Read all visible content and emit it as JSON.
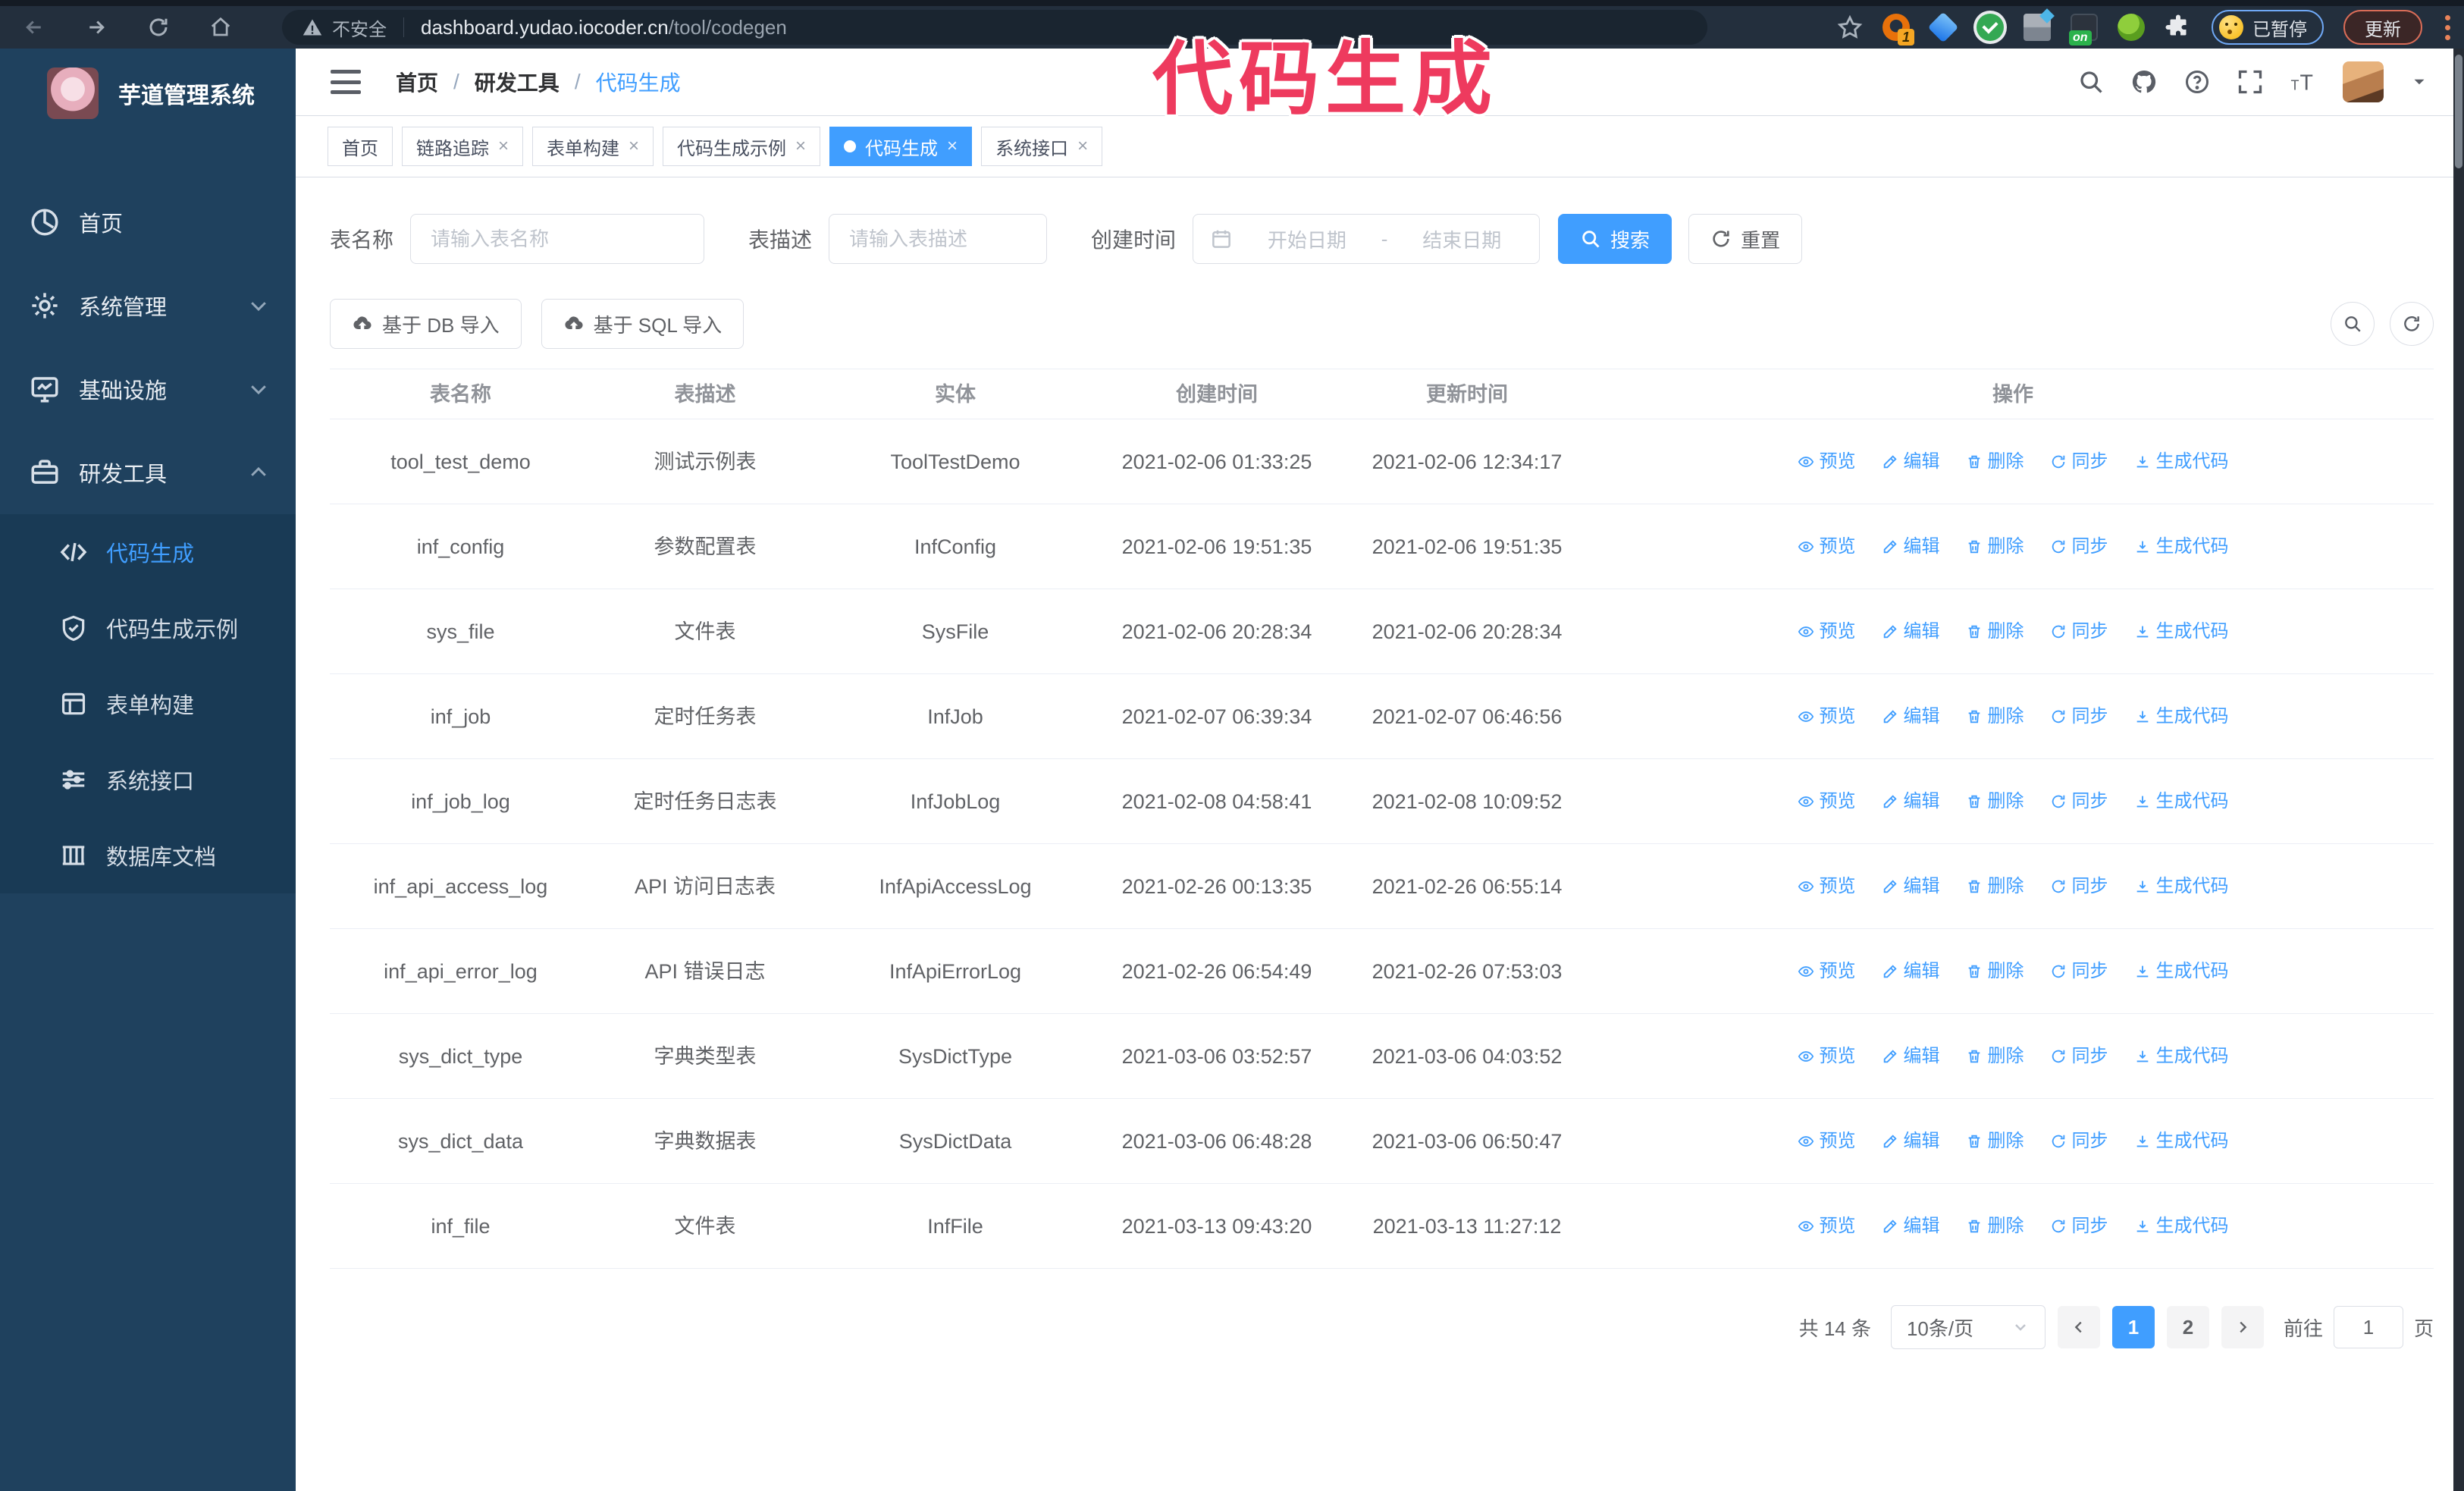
{
  "colors": {
    "primary": "#409eff",
    "sidebar_bg": "#1f415e",
    "submenu_bg": "#193a55",
    "watermark": "#ee3a5e"
  },
  "browser": {
    "security_label": "不安全",
    "url_host": "dashboard.yudao.iocoder.cn",
    "url_path": "/tool/codegen",
    "extension_badge": "1",
    "extension_on_badge": "on",
    "paused_chip": "已暂停",
    "update_button": "更新"
  },
  "overlay": {
    "watermark": "代码生成"
  },
  "sidebar": {
    "title": "芋道管理系统",
    "items": [
      {
        "label": "首页"
      },
      {
        "label": "系统管理"
      },
      {
        "label": "基础设施"
      },
      {
        "label": "研发工具"
      }
    ],
    "subitems": [
      {
        "label": "代码生成"
      },
      {
        "label": "代码生成示例"
      },
      {
        "label": "表单构建"
      },
      {
        "label": "系统接口"
      },
      {
        "label": "数据库文档"
      }
    ]
  },
  "header": {
    "breadcrumb": [
      "首页",
      "研发工具",
      "代码生成"
    ],
    "separator": "/"
  },
  "tabs": [
    {
      "label": "首页"
    },
    {
      "label": "链路追踪"
    },
    {
      "label": "表单构建"
    },
    {
      "label": "代码生成示例"
    },
    {
      "label": "代码生成"
    },
    {
      "label": "系统接口"
    }
  ],
  "filters": {
    "name_label": "表名称",
    "name_placeholder": "请输入表名称",
    "desc_label": "表描述",
    "desc_placeholder": "请输入表描述",
    "time_label": "创建时间",
    "start_placeholder": "开始日期",
    "range_separator": "-",
    "end_placeholder": "结束日期",
    "search_label": "搜索",
    "reset_label": "重置"
  },
  "toolbar": {
    "import_db": "基于 DB 导入",
    "import_sql": "基于 SQL 导入"
  },
  "table": {
    "columns": [
      "表名称",
      "表描述",
      "实体",
      "创建时间",
      "更新时间",
      "操作"
    ],
    "actions": [
      "预览",
      "编辑",
      "删除",
      "同步",
      "生成代码"
    ],
    "rows": [
      {
        "name": "tool_test_demo",
        "desc": "测试示例表",
        "entity": "ToolTestDemo",
        "created": "2021-02-06 01:33:25",
        "updated": "2021-02-06 12:34:17"
      },
      {
        "name": "inf_config",
        "desc": "参数配置表",
        "entity": "InfConfig",
        "created": "2021-02-06 19:51:35",
        "updated": "2021-02-06 19:51:35"
      },
      {
        "name": "sys_file",
        "desc": "文件表",
        "entity": "SysFile",
        "created": "2021-02-06 20:28:34",
        "updated": "2021-02-06 20:28:34"
      },
      {
        "name": "inf_job",
        "desc": "定时任务表",
        "entity": "InfJob",
        "created": "2021-02-07 06:39:34",
        "updated": "2021-02-07 06:46:56"
      },
      {
        "name": "inf_job_log",
        "desc": "定时任务日志表",
        "entity": "InfJobLog",
        "created": "2021-02-08 04:58:41",
        "updated": "2021-02-08 10:09:52"
      },
      {
        "name": "inf_api_access_log",
        "desc": "API 访问日志表",
        "entity": "InfApiAccessLog",
        "created": "2021-02-26 00:13:35",
        "updated": "2021-02-26 06:55:14"
      },
      {
        "name": "inf_api_error_log",
        "desc": "API 错误日志",
        "entity": "InfApiErrorLog",
        "created": "2021-02-26 06:54:49",
        "updated": "2021-02-26 07:53:03"
      },
      {
        "name": "sys_dict_type",
        "desc": "字典类型表",
        "entity": "SysDictType",
        "created": "2021-03-06 03:52:57",
        "updated": "2021-03-06 04:03:52"
      },
      {
        "name": "sys_dict_data",
        "desc": "字典数据表",
        "entity": "SysDictData",
        "created": "2021-03-06 06:48:28",
        "updated": "2021-03-06 06:50:47"
      },
      {
        "name": "inf_file",
        "desc": "文件表",
        "entity": "InfFile",
        "created": "2021-03-13 09:43:20",
        "updated": "2021-03-13 11:27:12"
      }
    ]
  },
  "pagination": {
    "total": "共 14 条",
    "page_size": "10条/页",
    "pages": [
      "1",
      "2"
    ],
    "goto_label": "前往",
    "goto_value": "1",
    "page_suffix": "页"
  }
}
